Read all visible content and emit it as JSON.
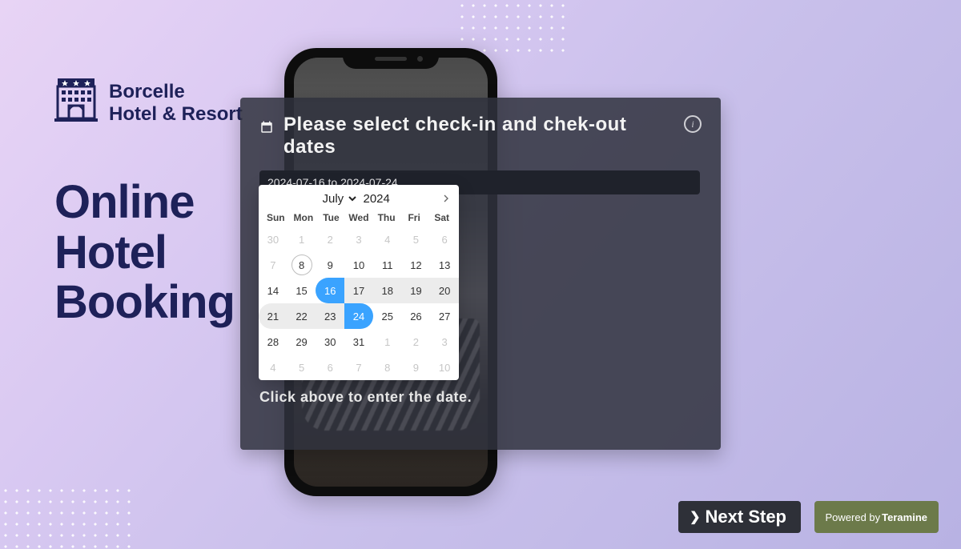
{
  "brand": {
    "line1": "Borcelle",
    "line2": "Hotel & Resort"
  },
  "hero": {
    "line1": "Online",
    "line2": "Hotel",
    "line3": "Booking"
  },
  "panel": {
    "title": "Please select check-in and chek-out dates",
    "date_value": "2024-07-16 to 2024-07-24",
    "helper": "Click above to enter the date."
  },
  "calendar": {
    "month_label": "July",
    "year": "2024",
    "dow": [
      "Sun",
      "Mon",
      "Tue",
      "Wed",
      "Thu",
      "Fri",
      "Sat"
    ],
    "today": 8,
    "range_start": 16,
    "range_end": 24,
    "leading_muted": [
      30,
      1,
      2,
      3,
      4,
      5,
      6,
      7
    ],
    "days": [
      8,
      9,
      10,
      11,
      12,
      13,
      14,
      15,
      16,
      17,
      18,
      19,
      20,
      21,
      22,
      23,
      24,
      25,
      26,
      27,
      28,
      29,
      30,
      31
    ],
    "trailing_muted": [
      1,
      2,
      3,
      4,
      5,
      6,
      7,
      8,
      9,
      10
    ]
  },
  "footer": {
    "next_label": "Next Step",
    "powered_prefix": "Powered by",
    "powered_name": "Teramine"
  }
}
